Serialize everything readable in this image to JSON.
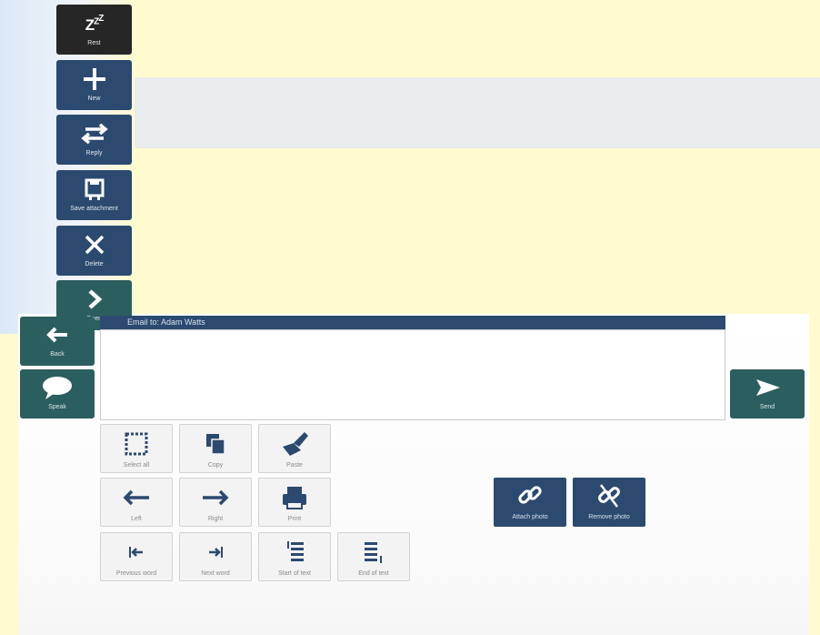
{
  "sidebar": {
    "items": [
      {
        "label": "Rest",
        "icon": "sleep-zzz-icon"
      },
      {
        "label": "New",
        "icon": "plus-icon"
      },
      {
        "label": "Reply",
        "icon": "reply-arrows-icon"
      },
      {
        "label": "Save attachment",
        "icon": "save-icon"
      },
      {
        "label": "Delete",
        "icon": "close-icon"
      },
      {
        "label": "Open",
        "icon": "chevron-right-icon"
      }
    ]
  },
  "compose": {
    "title": "Email to: Adam Watts",
    "back_label": "Back",
    "speak_label": "Speak",
    "send_label": "Send"
  },
  "edit_grid": {
    "select_all": "Select all",
    "copy": "Copy",
    "paste": "Paste",
    "left": "Left",
    "right": "Right",
    "print": "Print",
    "previous_word": "Previous word",
    "next_word": "Next word",
    "start_of_text": "Start of text",
    "end_of_text": "End of text"
  },
  "photo": {
    "attach_label": "Attach photo",
    "remove_label": "Remove photo"
  },
  "colors": {
    "navy": "#2c4a70",
    "teal": "#2b5e5e",
    "dark": "#262626",
    "background": "#fffbcf"
  }
}
